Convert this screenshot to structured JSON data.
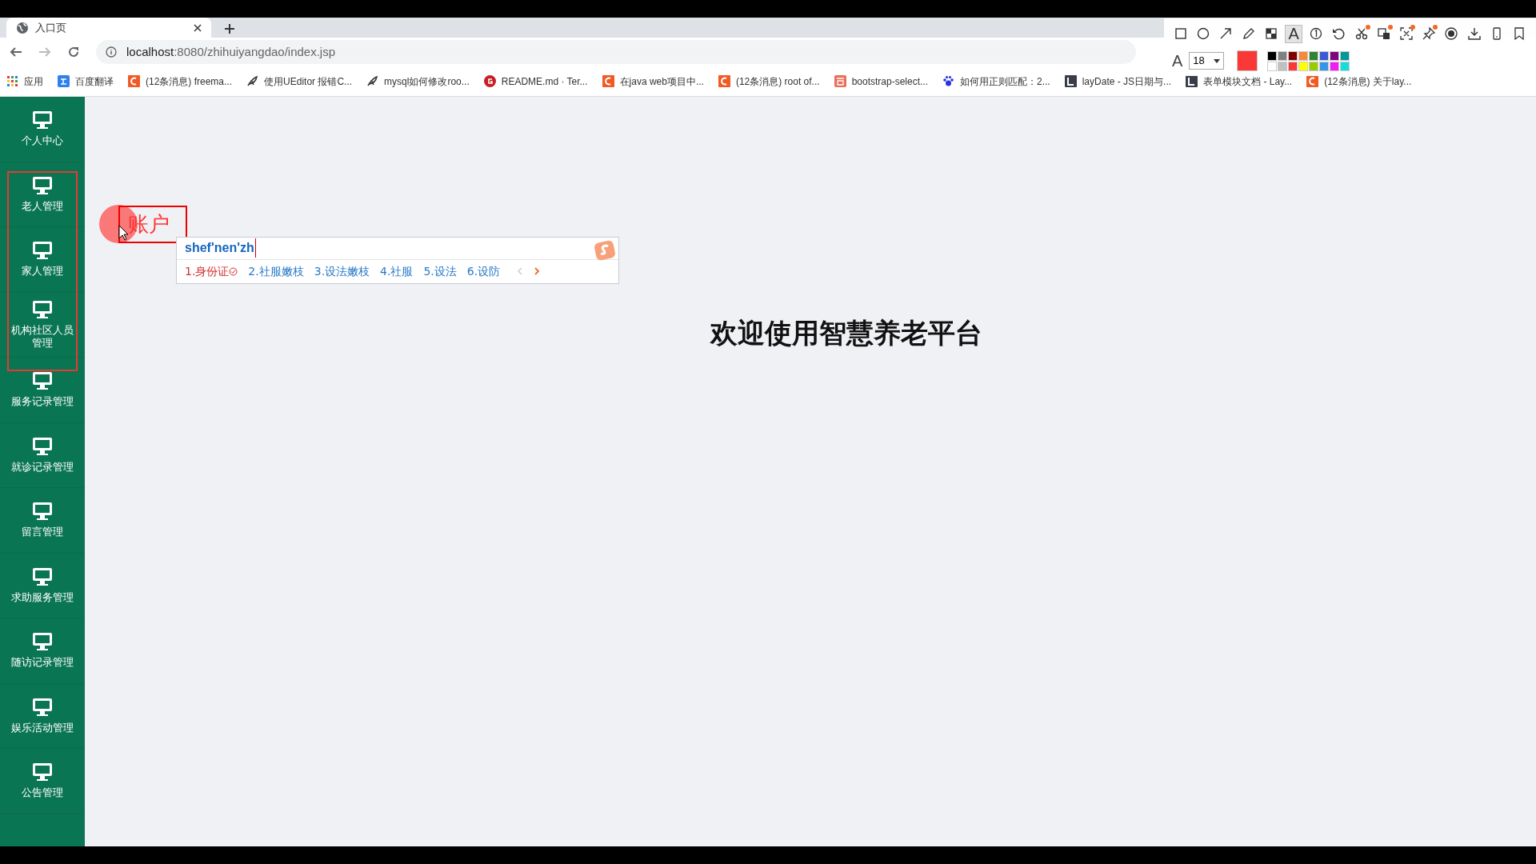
{
  "browser": {
    "tab": {
      "title": "入口页"
    },
    "address": {
      "host": "localhost",
      "rest": ":8080/zhihuiyangdao/index.jsp"
    },
    "bookmarks": [
      {
        "kind": "apps",
        "label": "应用"
      },
      {
        "kind": "translate",
        "label": "百度翻译"
      },
      {
        "kind": "csdn",
        "label": "(12条消息) freema..."
      },
      {
        "kind": "feather",
        "label": "使用UEditor 报错C..."
      },
      {
        "kind": "feather",
        "label": "mysql如何修改roo..."
      },
      {
        "kind": "gitee",
        "label": "README.md · Ter..."
      },
      {
        "kind": "csdn",
        "label": "在java web项目中..."
      },
      {
        "kind": "csdn",
        "label": "(12条消息) root of..."
      },
      {
        "kind": "jianshu",
        "label": "bootstrap-select..."
      },
      {
        "kind": "paw",
        "label": "如何用正则匹配：2..."
      },
      {
        "kind": "layui",
        "label": "layDate - JS日期与..."
      },
      {
        "kind": "layui",
        "label": "表单模块文档 - Lay..."
      },
      {
        "kind": "csdn",
        "label": "(12条消息) 关于lay..."
      }
    ]
  },
  "sidebar": {
    "items": [
      {
        "label": "个人中心"
      },
      {
        "label": "老人管理"
      },
      {
        "label": "家人管理"
      },
      {
        "label": "机构社区人员管理"
      },
      {
        "label": "服务记录管理"
      },
      {
        "label": "就诊记录管理"
      },
      {
        "label": "留言管理"
      },
      {
        "label": "求助服务管理"
      },
      {
        "label": "随访记录管理"
      },
      {
        "label": "娱乐活动管理"
      },
      {
        "label": "公告管理"
      }
    ]
  },
  "annotation_toolbar": {
    "tools": [
      {
        "kind": "rect",
        "selected": false,
        "badge": false
      },
      {
        "kind": "circle",
        "selected": false,
        "badge": false
      },
      {
        "kind": "arrow",
        "selected": false,
        "badge": false
      },
      {
        "kind": "pencil",
        "selected": false,
        "badge": false
      },
      {
        "kind": "mosaic",
        "selected": false,
        "badge": false
      },
      {
        "kind": "text",
        "label": "A",
        "selected": true,
        "badge": false
      },
      {
        "kind": "number",
        "selected": false,
        "badge": false
      },
      {
        "kind": "undo",
        "selected": false,
        "badge": false
      },
      {
        "kind": "scissors",
        "selected": false,
        "badge": true
      },
      {
        "kind": "translate",
        "selected": false,
        "badge": true
      },
      {
        "kind": "expand",
        "selected": false,
        "badge": true
      },
      {
        "kind": "pin",
        "selected": false,
        "badge": true
      },
      {
        "kind": "record",
        "selected": false,
        "badge": false
      },
      {
        "kind": "download",
        "selected": false,
        "badge": false
      },
      {
        "kind": "phone",
        "selected": false,
        "badge": false
      },
      {
        "kind": "bookmark",
        "selected": false,
        "badge": false
      }
    ],
    "size_label": "A",
    "font_size": "18",
    "swatches": [
      {
        "color": "#000000"
      },
      {
        "color": "#808080"
      },
      {
        "color": "#800000"
      },
      {
        "color": "#f7883a"
      },
      {
        "color": "#308430"
      },
      {
        "color": "#385ad3"
      },
      {
        "color": "#800080"
      },
      {
        "color": "#009999"
      },
      {
        "color": "#ffffff"
      },
      {
        "color": "#c0c0c0"
      },
      {
        "color": "#fb3838"
      },
      {
        "color": "#ffff00"
      },
      {
        "color": "#99cc00"
      },
      {
        "color": "#3894e4"
      },
      {
        "color": "#f31bf3"
      },
      {
        "color": "#16dcdc"
      }
    ]
  },
  "annotation": {
    "text": "账户"
  },
  "ime": {
    "input": "shef'nen'zh",
    "candidates": [
      {
        "label": "1.身份证",
        "selected": true
      },
      {
        "label": "2.社服嫩枝",
        "selected": false
      },
      {
        "label": "3.设法嫩枝",
        "selected": false
      },
      {
        "label": "4.社服",
        "selected": false
      },
      {
        "label": "5.设法",
        "selected": false
      },
      {
        "label": "6.设防",
        "selected": false
      }
    ]
  },
  "heading": "欢迎使用智慧养老平台"
}
